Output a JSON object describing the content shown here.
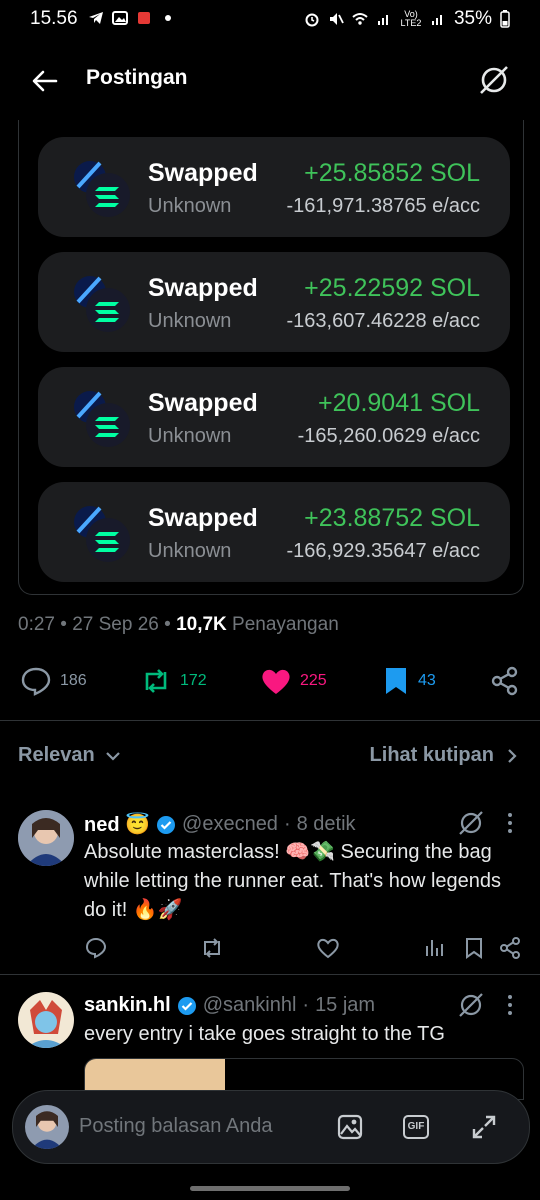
{
  "status_bar": {
    "time": "15.56",
    "battery": "35%",
    "network": "Vo) LTE2"
  },
  "header": {
    "title": "Postingan"
  },
  "swaps": [
    {
      "label": "Swapped",
      "sub": "Unknown",
      "amount": "+25.85852 SOL",
      "rate": "-161,971.38765 e/acc"
    },
    {
      "label": "Swapped",
      "sub": "Unknown",
      "amount": "+25.22592 SOL",
      "rate": "-163,607.46228 e/acc"
    },
    {
      "label": "Swapped",
      "sub": "Unknown",
      "amount": "+20.9041 SOL",
      "rate": "-165,260.0629 e/acc"
    },
    {
      "label": "Swapped",
      "sub": "Unknown",
      "amount": "+23.88752 SOL",
      "rate": "-166,929.35647 e/acc"
    }
  ],
  "post_meta": {
    "time": "0:27",
    "date": "27 Sep 26",
    "views": "10,7K",
    "views_label": "Penayangan"
  },
  "actions": {
    "replies": "186",
    "reposts": "172",
    "likes": "225",
    "bookmarks": "43"
  },
  "sort": {
    "label": "Relevan",
    "quotes_label": "Lihat kutipan"
  },
  "replies": [
    {
      "name": "ned 😇",
      "handle": "@execned",
      "time": "8 detik",
      "text": "Absolute masterclass! 🧠💸 Securing the bag while letting the runner eat. That's how legends do it! 🔥🚀"
    },
    {
      "name": "sankin.hl",
      "handle": "@sankinhl",
      "time": "15 jam",
      "text": "every entry i take goes straight to the TG"
    }
  ],
  "composer": {
    "placeholder": "Posting balasan Anda",
    "gif_label": "GIF"
  },
  "colors": {
    "accent_green": "#3fc35a",
    "like_pink": "#f91880",
    "repost_green": "#00ba7c",
    "bookmark_blue": "#1d9bf0",
    "verified_blue": "#1d9bf0"
  }
}
